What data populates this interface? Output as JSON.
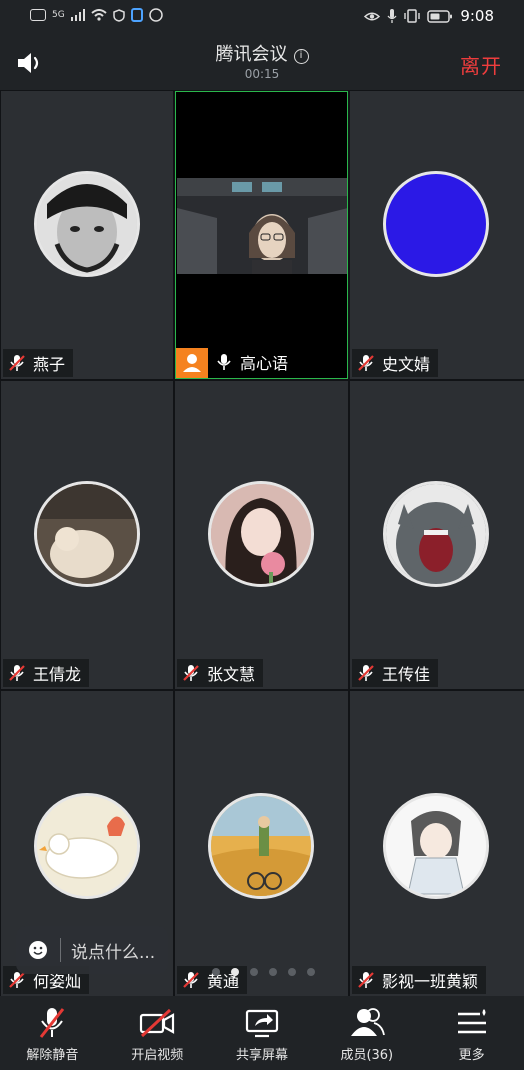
{
  "status_bar": {
    "left_icons": [
      "hd-icon",
      "signal-5g-icon",
      "wifi-icon",
      "shield-icon",
      "nfc-icon",
      "app-icon"
    ],
    "network_label": "5G",
    "right_icons": [
      "eye-icon",
      "mic-status-icon",
      "vibrate-icon",
      "battery-icon"
    ],
    "time": "9:08"
  },
  "header": {
    "title": "腾讯会议",
    "timer": "00:15",
    "leave_label": "离开"
  },
  "participants": [
    {
      "name": "燕子",
      "muted": true,
      "host": false,
      "avatar_color": "#d9d9d9"
    },
    {
      "name": "高心语",
      "muted": false,
      "host": true,
      "video": true
    },
    {
      "name": "史文婧",
      "muted": true,
      "host": false,
      "avatar_color": "#2b19e6"
    },
    {
      "name": "王倩龙",
      "muted": true,
      "host": false,
      "avatar_color": "#8a7b6c"
    },
    {
      "name": "张文慧",
      "muted": true,
      "host": false,
      "avatar_color": "#c9a7a3"
    },
    {
      "name": "王传佳",
      "muted": true,
      "host": false,
      "avatar_color": "#6f7478"
    },
    {
      "name": "何姿灿",
      "muted": true,
      "host": false,
      "avatar_color": "#efe9d5"
    },
    {
      "name": "黄通",
      "muted": true,
      "host": false,
      "avatar_color": "#e3b75b"
    },
    {
      "name": "影视一班黄颖",
      "muted": true,
      "host": false,
      "avatar_color": "#f2f2f2"
    }
  ],
  "chat": {
    "placeholder": "说点什么..."
  },
  "pagination": {
    "total": 6,
    "current": 2
  },
  "toolbar": {
    "unmute": "解除静音",
    "video": "开启视频",
    "share": "共享屏幕",
    "members": "成员(36)",
    "more": "更多"
  },
  "colors": {
    "accent_leave": "#ee3d3d",
    "active_speaker": "#2bb74c",
    "host_badge": "#f5821f",
    "muted_icon": "#e53935"
  }
}
